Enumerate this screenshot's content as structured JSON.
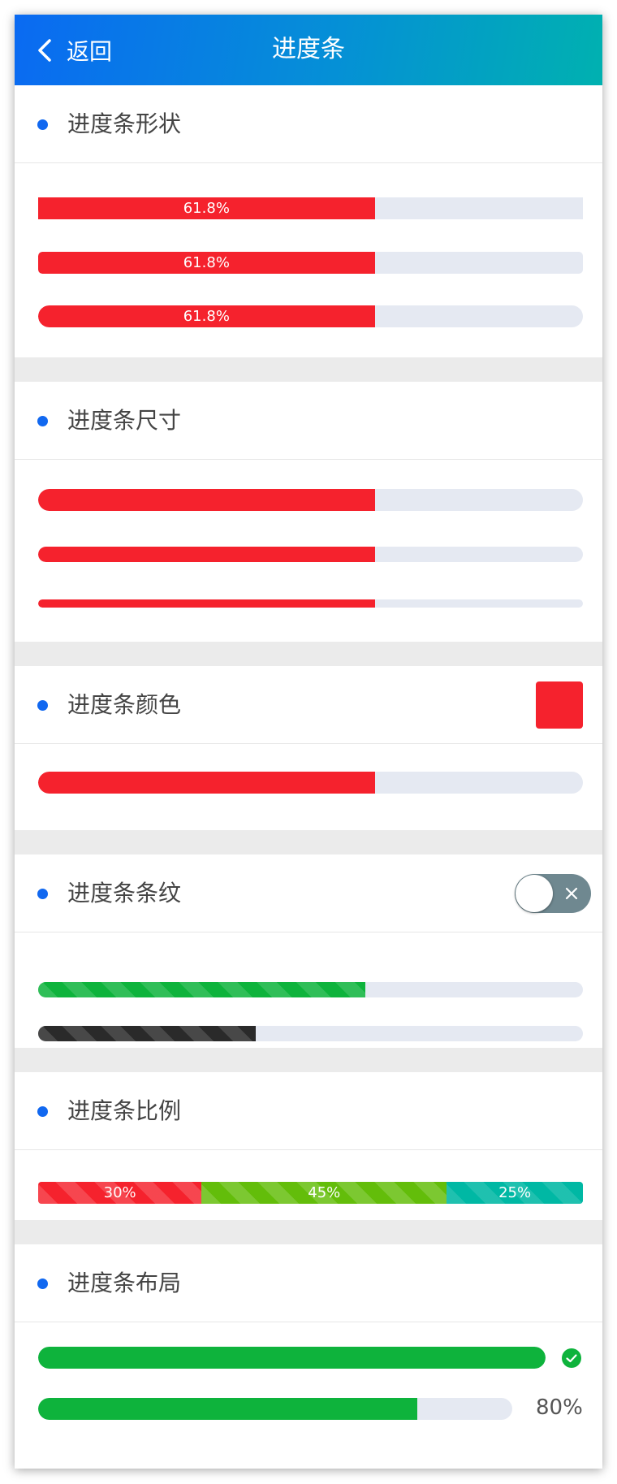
{
  "navbar": {
    "back_label": "返回",
    "title": "进度条"
  },
  "sections": {
    "shape": {
      "title": "进度条形状",
      "bars": [
        {
          "percent": 61.8,
          "label": "61.8%",
          "corner": "square"
        },
        {
          "percent": 61.8,
          "label": "61.8%",
          "corner": "small-radius"
        },
        {
          "percent": 61.8,
          "label": "61.8%",
          "corner": "round"
        }
      ]
    },
    "size": {
      "title": "进度条尺寸",
      "bars": [
        {
          "percent": 61.8
        },
        {
          "percent": 61.8
        },
        {
          "percent": 61.8
        }
      ]
    },
    "color": {
      "title": "进度条颜色",
      "selected_color": "#f5222d",
      "bar": {
        "percent": 61.8
      }
    },
    "stripe": {
      "title": "进度条条纹",
      "switch_on": false,
      "bars": [
        {
          "percent": 60,
          "color": "#0eb33c"
        },
        {
          "percent": 40,
          "color": "#2a2a2a"
        }
      ]
    },
    "ratio": {
      "title": "进度条比例",
      "segments": [
        {
          "percent": 30,
          "label": "30%",
          "color": "#f5222d"
        },
        {
          "percent": 45,
          "label": "45%",
          "color": "#63bd0a"
        },
        {
          "percent": 25,
          "label": "25%",
          "color": "#00b8a4"
        }
      ]
    },
    "layout": {
      "title": "进度条布局",
      "bars": [
        {
          "percent": 100,
          "status": "success"
        },
        {
          "percent": 80,
          "label": "80%"
        }
      ]
    }
  },
  "colors": {
    "primary": "#1168f0",
    "bar_red": "#f5222d",
    "bar_green": "#0eb33c",
    "track": "#e5e9f2"
  }
}
